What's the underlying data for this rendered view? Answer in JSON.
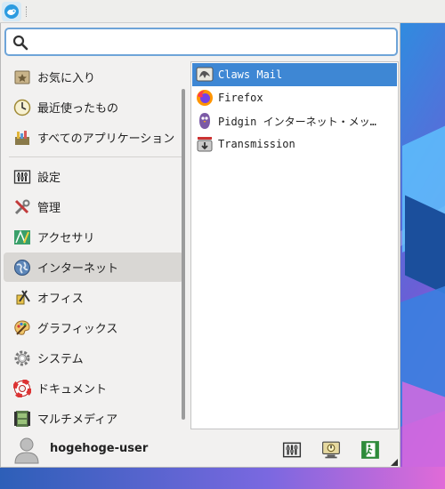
{
  "search": {
    "value": "",
    "placeholder": ""
  },
  "categories": [
    {
      "label": "お気に入り",
      "icon": "favorites-icon"
    },
    {
      "label": "最近使ったもの",
      "icon": "recent-clock-icon"
    },
    {
      "label": "すべてのアプリケーション",
      "icon": "all-apps-icon"
    },
    {
      "label": "設定",
      "icon": "settings-icon"
    },
    {
      "label": "管理",
      "icon": "admin-tools-icon"
    },
    {
      "label": "アクセサリ",
      "icon": "accessories-icon"
    },
    {
      "label": "インターネット",
      "icon": "internet-globe-icon"
    },
    {
      "label": "オフィス",
      "icon": "office-icon"
    },
    {
      "label": "グラフィックス",
      "icon": "graphics-palette-icon"
    },
    {
      "label": "システム",
      "icon": "system-gear-icon"
    },
    {
      "label": "ドキュメント",
      "icon": "help-lifebuoy-icon"
    },
    {
      "label": "マルチメディア",
      "icon": "multimedia-film-icon"
    }
  ],
  "active_category": "インターネット",
  "apps": [
    {
      "label": "Claws Mail",
      "icon": "claws-mail-icon"
    },
    {
      "label": "Firefox",
      "icon": "firefox-icon"
    },
    {
      "label": "Pidgin インターネット・メッ…",
      "icon": "pidgin-icon"
    },
    {
      "label": "Transmission",
      "icon": "transmission-icon"
    }
  ],
  "selected_app": "Claws Mail",
  "user": {
    "name": "hogehoge-user"
  },
  "colors": {
    "selection": "#3e87d4",
    "search_border": "#6ea4d8",
    "menu_bg": "#f2f1f0"
  }
}
